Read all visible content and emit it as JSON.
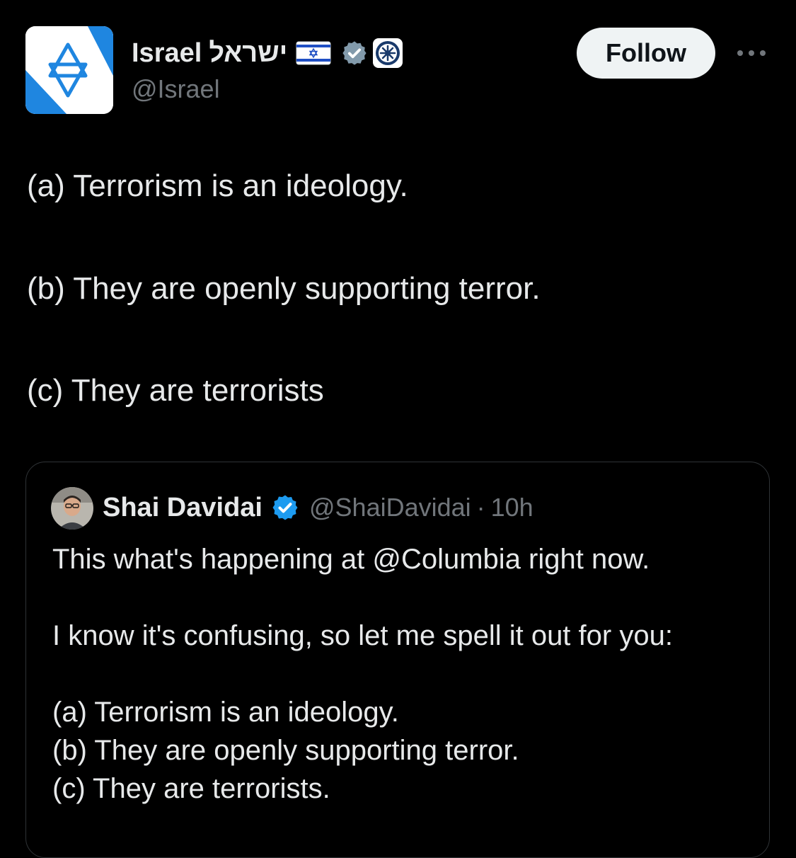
{
  "author": {
    "display_name": "Israel",
    "hebrew_name": "ישראל",
    "handle": "@Israel",
    "flag_icon": "israel-flag-icon",
    "verified_icon": "gray-verified-checkmark-icon",
    "affiliation_icon": "government-emblem-icon",
    "verified_color": "#829aab"
  },
  "follow_button": {
    "label": "Follow"
  },
  "more_icon": "more-options-icon",
  "post": {
    "lines": [
      "(a) Terrorism is an ideology.",
      "(b) They are openly supporting terror.",
      "(c) They are terrorists"
    ]
  },
  "quoted_post": {
    "author": {
      "display_name": "Shai Davidai",
      "handle": "@ShaiDavidai",
      "separator": "·",
      "time": "10h",
      "verified_icon": "blue-verified-checkmark-icon",
      "verified_color": "#1d9bf0"
    },
    "lines": [
      "This what's happening at @Columbia right now.",
      "I know it's confusing, so let me spell it out for you:",
      "(a) Terrorism is an ideology.",
      "(b) They are openly supporting terror.",
      "(c) They are terrorists."
    ]
  },
  "colors": {
    "background": "#000000",
    "primary_text": "#e7e9ea",
    "secondary_text": "#71767b",
    "border": "#2f3336",
    "israel_blue": "#0038b8"
  }
}
